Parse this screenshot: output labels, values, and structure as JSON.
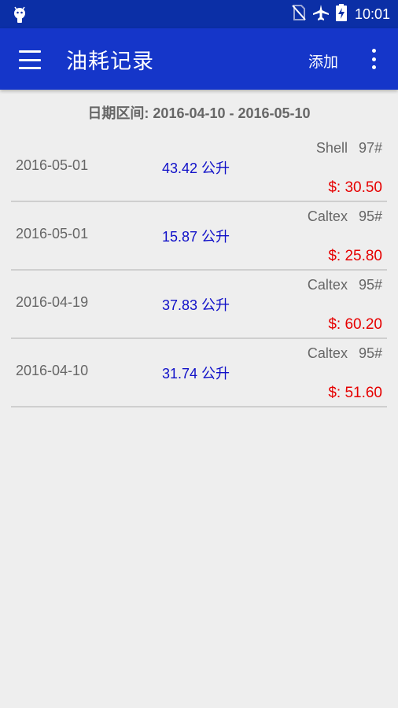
{
  "status_bar": {
    "time": "10:01",
    "icons": [
      "android-icon",
      "no-sim-icon",
      "airplane-icon",
      "battery-charging-icon"
    ]
  },
  "toolbar": {
    "title": "油耗记录",
    "add_label": "添加",
    "menu_icon": "hamburger-menu-icon",
    "more_icon": "more-vert-icon"
  },
  "date_range": "日期区间: 2016-04-10 - 2016-05-10",
  "records": [
    {
      "date": "2016-05-01",
      "volume": "43.42 公升",
      "brand": "Shell",
      "grade": "97#",
      "price": "$: 30.50"
    },
    {
      "date": "2016-05-01",
      "volume": "15.87 公升",
      "brand": "Caltex",
      "grade": "95#",
      "price": "$: 25.80"
    },
    {
      "date": "2016-04-19",
      "volume": "37.83 公升",
      "brand": "Caltex",
      "grade": "95#",
      "price": "$: 60.20"
    },
    {
      "date": "2016-04-10",
      "volume": "31.74 公升",
      "brand": "Caltex",
      "grade": "95#",
      "price": "$: 51.60"
    }
  ],
  "colors": {
    "status_bar": "#0b2fa6",
    "toolbar": "#1536c9",
    "volume_text": "#1010c8",
    "price_text": "#e60000",
    "background": "#eeeeee"
  }
}
